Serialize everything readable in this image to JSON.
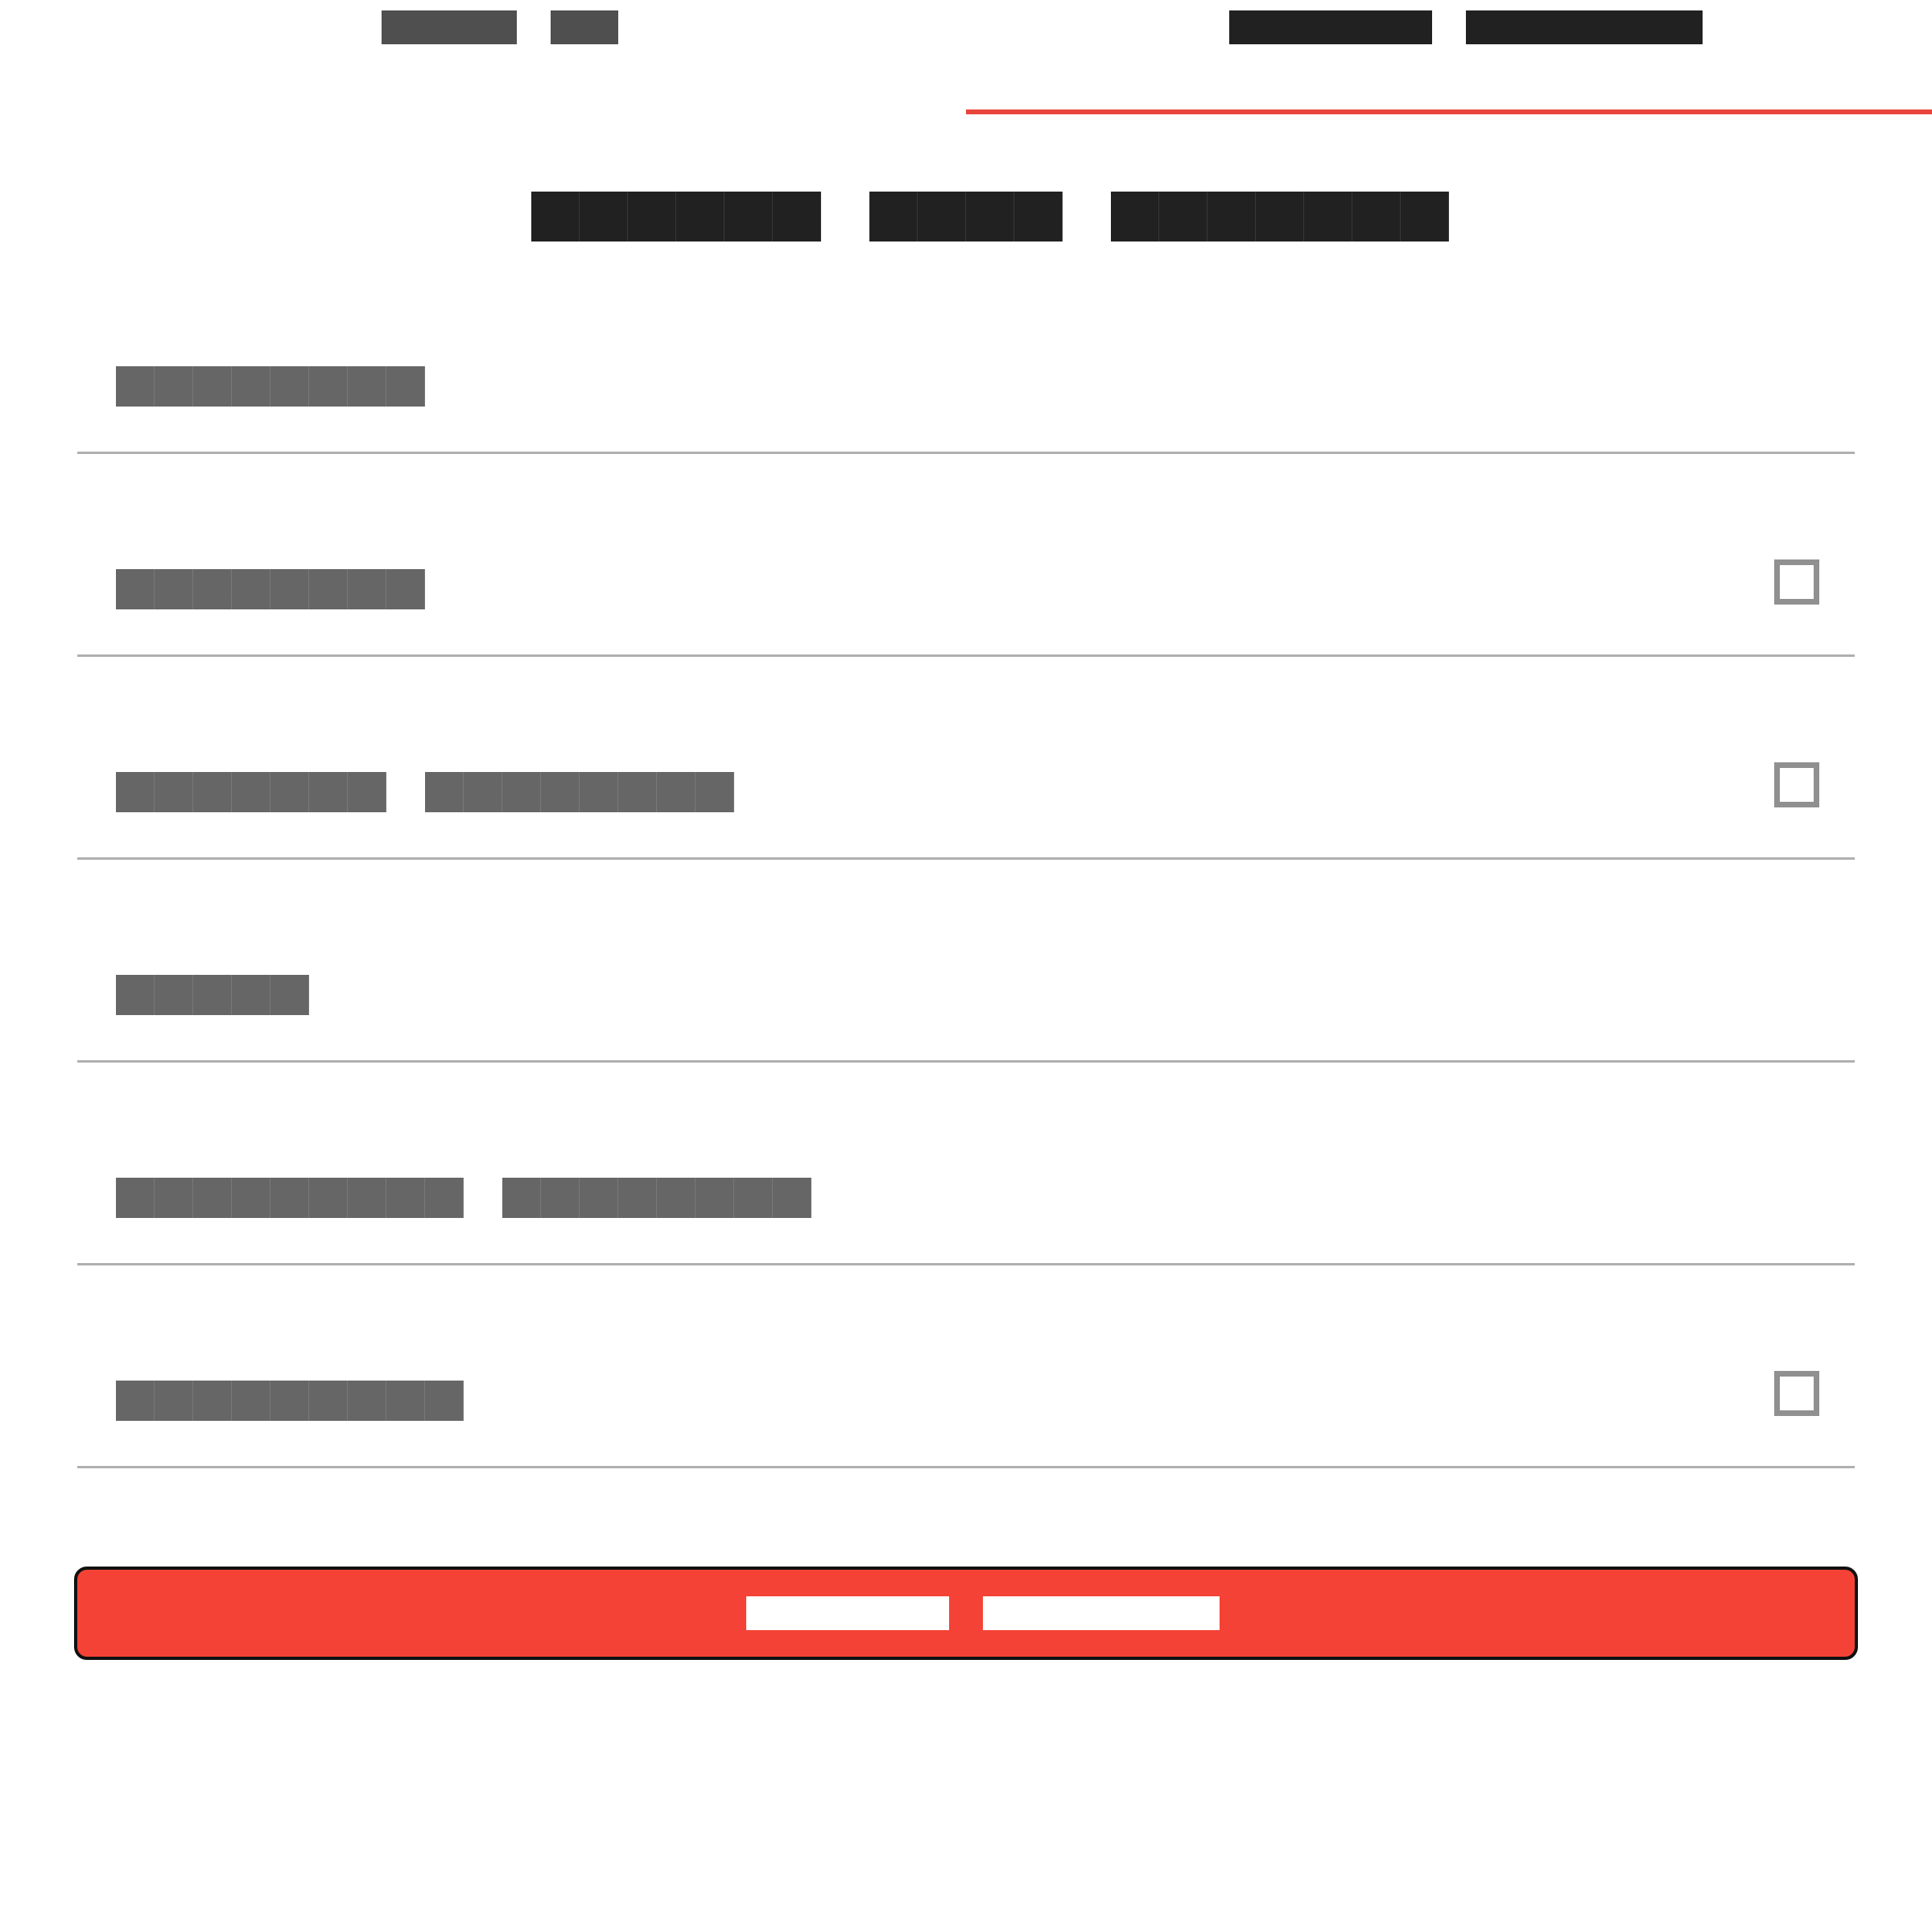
{
  "tabs": [
    {
      "label": "█████ ██",
      "selected": false
    },
    {
      "label": "██████ ███████",
      "selected": true
    }
  ],
  "page_title": "██████ ████ ███████",
  "settings": [
    {
      "label": "████████",
      "has_checkbox": false,
      "checked": false
    },
    {
      "label": "████████",
      "has_checkbox": true,
      "checked": false
    },
    {
      "label": "███████ ████████",
      "has_checkbox": true,
      "checked": false
    },
    {
      "label": "█████",
      "has_checkbox": false,
      "checked": false
    },
    {
      "label": "█████████ ████████",
      "has_checkbox": false,
      "checked": false
    },
    {
      "label": "█████████",
      "has_checkbox": true,
      "checked": false
    }
  ],
  "action_button": {
    "label": "██████ ███████"
  },
  "colors": {
    "accent": "#f44336",
    "tab_indicator": "#e8453c",
    "divider": "#b0b0b0",
    "label_text": "#666666",
    "title_text": "#212121",
    "checkbox_border": "#909090"
  }
}
